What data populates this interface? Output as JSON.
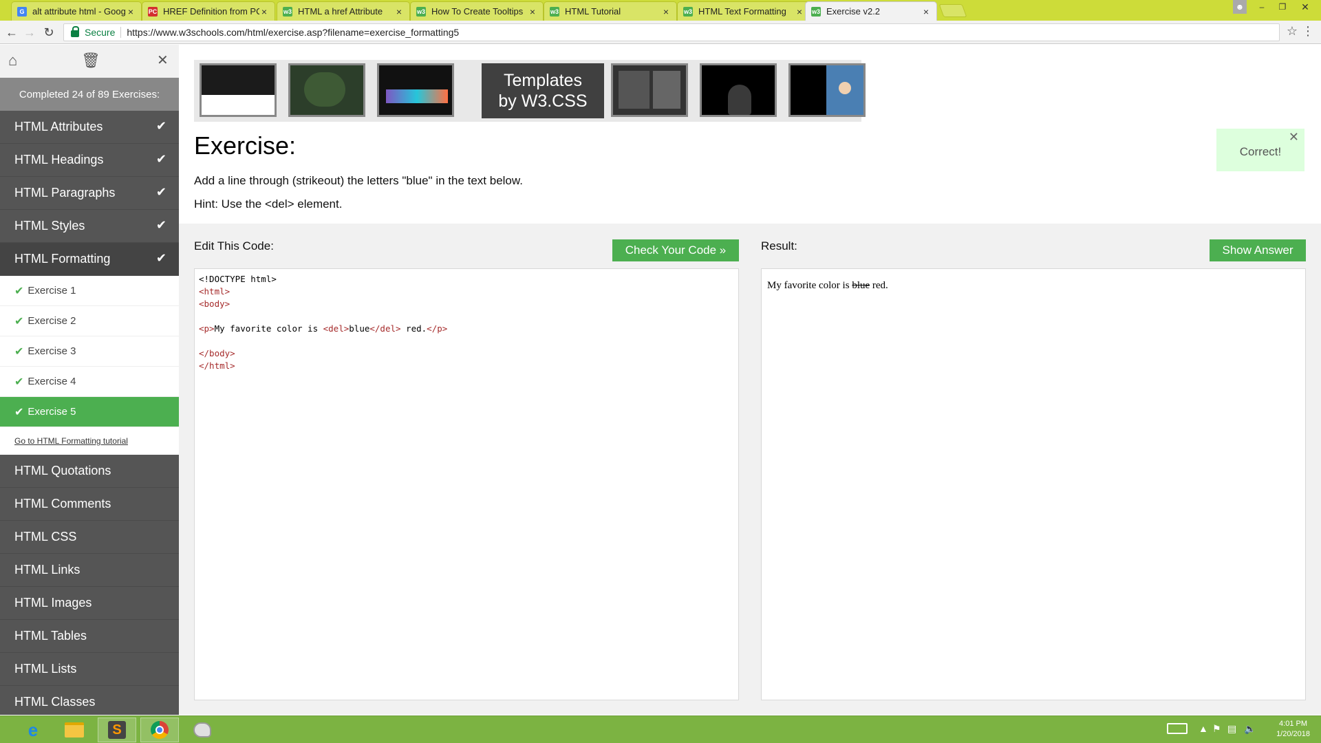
{
  "browser": {
    "tabs": [
      {
        "label": "alt attribute html - Goog",
        "icon": "google-icon",
        "color": "#4285f4",
        "glyph": "G"
      },
      {
        "label": "HREF Definition from PC",
        "icon": "pc-icon",
        "color": "#d32f2f",
        "glyph": "PC"
      },
      {
        "label": "HTML a href Attribute",
        "icon": "w3schools-icon",
        "color": "#4caf50",
        "glyph": "w3"
      },
      {
        "label": "How To Create Tooltips",
        "icon": "w3schools-icon",
        "color": "#4caf50",
        "glyph": "w3"
      },
      {
        "label": "HTML Tutorial",
        "icon": "w3schools-icon",
        "color": "#4caf50",
        "glyph": "w3"
      },
      {
        "label": "HTML Text Formatting",
        "icon": "w3schools-icon",
        "color": "#4caf50",
        "glyph": "w3"
      },
      {
        "label": "Exercise v2.2",
        "icon": "w3schools-icon",
        "color": "#4caf50",
        "glyph": "w3",
        "active": true
      }
    ],
    "secure_label": "Secure",
    "url": "https://www.w3schools.com/html/exercise.asp?filename=exercise_formatting5"
  },
  "sidebar": {
    "progress": "Completed 24 of 89 Exercises:",
    "items_before": [
      {
        "label": "HTML Attributes",
        "done": true
      },
      {
        "label": "HTML Headings",
        "done": true
      },
      {
        "label": "HTML Paragraphs",
        "done": true
      },
      {
        "label": "HTML Styles",
        "done": true
      },
      {
        "label": "HTML Formatting",
        "done": true
      }
    ],
    "exercises": [
      {
        "label": "Exercise 1"
      },
      {
        "label": "Exercise 2"
      },
      {
        "label": "Exercise 3"
      },
      {
        "label": "Exercise 4"
      },
      {
        "label": "Exercise 5",
        "active": true
      }
    ],
    "tutorial_link": "Go to HTML Formatting tutorial",
    "items_after": [
      {
        "label": "HTML Quotations"
      },
      {
        "label": "HTML Comments"
      },
      {
        "label": "HTML CSS"
      },
      {
        "label": "HTML Links"
      },
      {
        "label": "HTML Images"
      },
      {
        "label": "HTML Tables"
      },
      {
        "label": "HTML Lists"
      },
      {
        "label": "HTML Classes"
      }
    ]
  },
  "ad": {
    "line1": "Templates",
    "line2": "by W3.CSS"
  },
  "exercise": {
    "title": "Exercise:",
    "description": "Add a line through (strikeout) the letters \"blue\" in the text below.",
    "hint": "Hint: Use the <del> element.",
    "correct_label": "Correct!"
  },
  "editor": {
    "label": "Edit This Code:",
    "check_button": "Check Your Code »",
    "lines": [
      [
        {
          "t": "<!DOCTYPE html>",
          "c": "plain"
        }
      ],
      [
        {
          "t": "<html>",
          "c": "tag"
        }
      ],
      [
        {
          "t": "<body>",
          "c": "tag"
        }
      ],
      [],
      [
        {
          "t": "<p>",
          "c": "tag"
        },
        {
          "t": "My favorite color is ",
          "c": "plain"
        },
        {
          "t": "<del>",
          "c": "tag"
        },
        {
          "t": "blue",
          "c": "plain"
        },
        {
          "t": "</del>",
          "c": "tag"
        },
        {
          "t": " red.",
          "c": "plain"
        },
        {
          "t": "</p>",
          "c": "tag"
        }
      ],
      [],
      [
        {
          "t": "</body>",
          "c": "tag"
        }
      ],
      [
        {
          "t": "</html>",
          "c": "tag"
        }
      ]
    ]
  },
  "result": {
    "label": "Result:",
    "show_answer_button": "Show Answer",
    "text_before": "My favorite color is ",
    "text_struck": "blue",
    "text_after": " red."
  },
  "taskbar": {
    "time": "4:01 PM",
    "date": "1/20/2018"
  }
}
